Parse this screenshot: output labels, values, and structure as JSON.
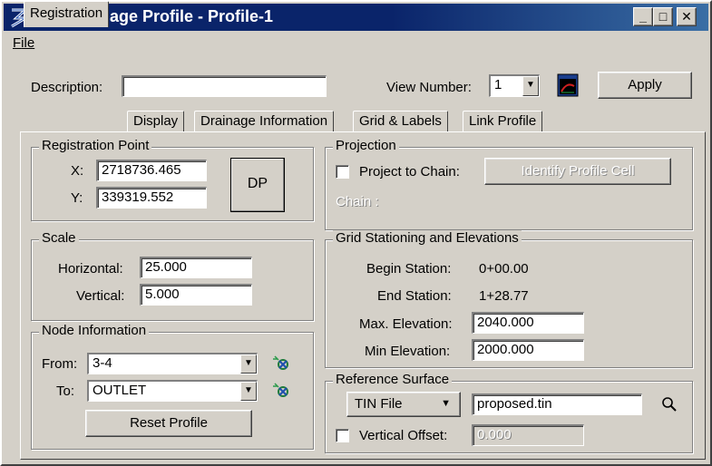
{
  "window": {
    "title": "Edit Drainage Profile - Profile-1",
    "minimize": "_",
    "maximize": "□",
    "close": "✕"
  },
  "menu": {
    "file": "File"
  },
  "header": {
    "description_label": "Description:",
    "description_value": "",
    "view_number_label": "View Number:",
    "view_number_value": "1",
    "view_icon": "view-window-icon",
    "apply": "Apply"
  },
  "tabs": [
    {
      "label": "Registration",
      "active": true
    },
    {
      "label": "Display"
    },
    {
      "label": "Drainage Information"
    },
    {
      "label": "Grid & Labels"
    },
    {
      "label": "Link Profile"
    }
  ],
  "registration_point": {
    "title": "Registration Point",
    "x_label": "X:",
    "x_value": "2718736.465",
    "y_label": "Y:",
    "y_value": "339319.552",
    "dp_button": "DP"
  },
  "scale": {
    "title": "Scale",
    "horizontal_label": "Horizontal:",
    "horizontal_value": "25.000",
    "vertical_label": "Vertical:",
    "vertical_value": "5.000"
  },
  "node_information": {
    "title": "Node Information",
    "from_label": "From:",
    "from_value": "3-4",
    "to_label": "To:",
    "to_value": "OUTLET",
    "node_icon": "node-locate-icon",
    "reset_button": "Reset Profile"
  },
  "projection": {
    "title": "Projection",
    "project_checkbox_label": "Project to Chain:",
    "project_checked": false,
    "identify_button": "Identify Profile Cell",
    "chain_label": "Chain :"
  },
  "grid": {
    "title": "Grid Stationing and Elevations",
    "begin_station_label": "Begin Station:",
    "begin_station_value": "0+00.00",
    "end_station_label": "End Station:",
    "end_station_value": "1+28.77",
    "max_elev_label": "Max. Elevation:",
    "max_elev_value": "2040.000",
    "min_elev_label": "Min Elevation:",
    "min_elev_value": "2000.000"
  },
  "reference_surface": {
    "title": "Reference Surface",
    "type_value": "TIN File",
    "file_value": "proposed.tin",
    "search_icon": "search-icon",
    "vertical_offset_label": "Vertical Offset:",
    "vertical_offset_checked": false,
    "vertical_offset_value": "0.000"
  }
}
